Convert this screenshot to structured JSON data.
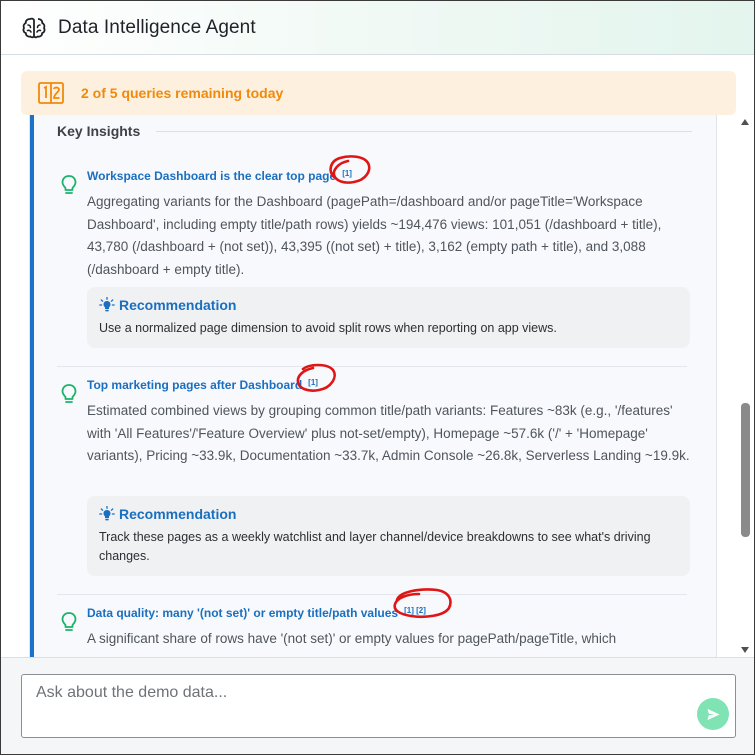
{
  "header": {
    "title": "Data Intelligence Agent",
    "icon": "brain-icon"
  },
  "quota": {
    "text": "2 of 5 queries remaining today",
    "icon": "counter-icon",
    "color": "#f08a0c",
    "background": "#fdf0de"
  },
  "section": {
    "title": "Key Insights"
  },
  "insights": [
    {
      "title": "Workspace Dashboard is the clear top page",
      "citations": "[1]",
      "body": "Aggregating variants for the Dashboard (pagePath=/dashboard and/or pageTitle='Workspace Dashboard', including empty title/path rows) yields ~194,476 views: 101,051 (/dashboard + title), 43,780 (/dashboard + (not set)), 43,395 ((not set) + title), 3,162 (empty path + title), and 3,088 (/dashboard + empty title).",
      "recommendation": {
        "label": "Recommendation",
        "text": "Use a normalized page dimension to avoid split rows when reporting on app views."
      }
    },
    {
      "title": "Top marketing pages after Dashboard",
      "citations": "[1]",
      "body": "Estimated combined views by grouping common title/path variants: Features ~83k (e.g., '/features' with 'All Features'/'Feature Overview' plus not-set/empty), Homepage ~57.6k ('/' + 'Homepage' variants), Pricing ~33.9k, Documentation ~33.7k, Admin Console ~26.8k, Serverless Landing ~19.9k.",
      "recommendation": {
        "label": "Recommendation",
        "text": "Track these pages as a weekly watchlist and layer channel/device breakdowns to see what's driving changes."
      }
    },
    {
      "title": "Data quality: many '(not set)' or empty title/path values",
      "citations": "[1] [2]",
      "body": "A significant share of rows have '(not set)' or empty values for pagePath/pageTitle, which"
    }
  ],
  "composer": {
    "placeholder": "Ask about the demo data..."
  },
  "colors": {
    "accent": "#1a73c8",
    "link": "#1a6fc0",
    "send": "#7fe3b3",
    "bulb": "#1bb36b",
    "annotation": "#e01515"
  }
}
